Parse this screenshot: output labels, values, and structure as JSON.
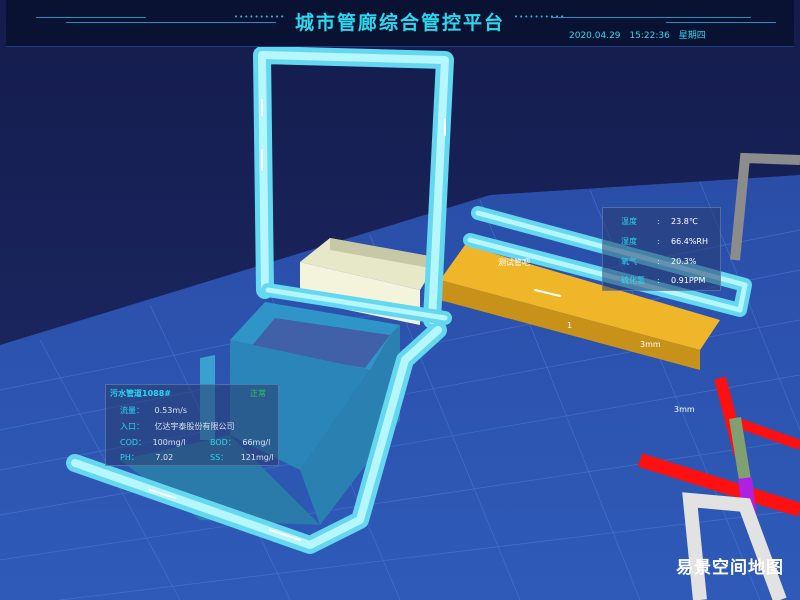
{
  "header": {
    "title": "城市管廊综合管控平台",
    "date": "2020.04.29",
    "time": "15:22:36",
    "weekday": "星期四",
    "dots": "••••••••••"
  },
  "pipe_panel": {
    "title": "污水管道1088#",
    "status": "正常",
    "flow_label": "流量：",
    "flow_value": "0.53m/s",
    "inlet_label": "入口：",
    "inlet_value": "亿达宇泰股份有限公司",
    "cod_label": "COD：",
    "cod_value": "100mg/l",
    "bod_label": "BOD：",
    "bod_value": "66mg/l",
    "ph_label": "PH：",
    "ph_value": "7.02",
    "ss_label": "SS：",
    "ss_value": "121mg/l"
  },
  "env_panel": {
    "rows": [
      {
        "label": "温度",
        "sep": ":",
        "value": "23.8℃"
      },
      {
        "label": "湿度",
        "sep": ":",
        "value": "66.4%RH"
      },
      {
        "label": "氧气",
        "sep": ":",
        "value": "20.3%"
      },
      {
        "label": "硫化氢",
        "sep": ":",
        "value": "0.91PPM"
      }
    ]
  },
  "scene_labels": {
    "box_label": "测试管吧",
    "mark_1": "1",
    "mark_2": "3mm",
    "mark_3": "3mm"
  },
  "watermark": "易景空间地图",
  "colors": {
    "background": "#17225a",
    "grid": "#3b67c6",
    "pipe": "#7ff0ff",
    "accent_title": "#2ad8f0",
    "status_ok": "#2cc95a",
    "orange_tray": "#f0b62a",
    "red_pipe": "#ff1010",
    "purple_pipe": "#b020e0",
    "green_pipe": "#80a070",
    "grey_pipe": "#8c8c8c"
  }
}
